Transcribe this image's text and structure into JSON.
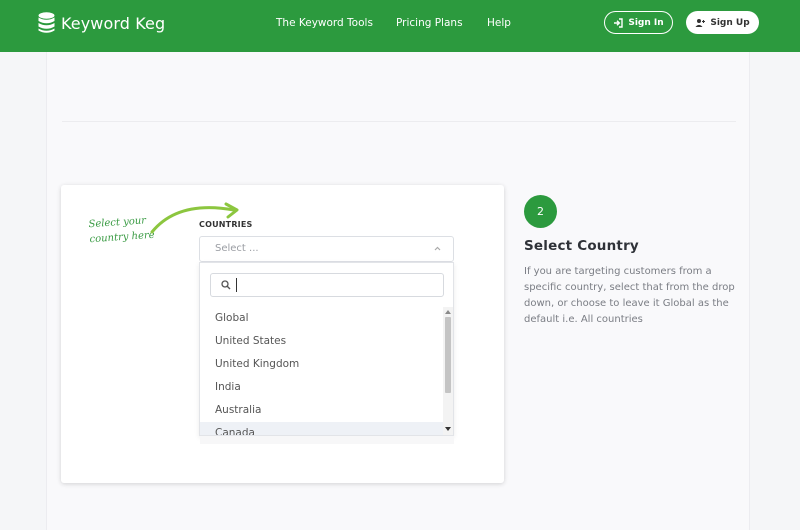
{
  "header": {
    "brand": "Keyword Keg",
    "nav": [
      "The Keyword Tools",
      "Pricing Plans",
      "Help"
    ],
    "signin_label": "Sign In",
    "signup_label": "Sign Up",
    "bg_color": "#2c9a3e"
  },
  "demo": {
    "annotation_line1": "Select your",
    "annotation_line2": "country here",
    "countries_label": "COUNTRIES",
    "select_placeholder": "Select ...",
    "search_value": "",
    "options": [
      "Global",
      "United States",
      "United Kingdom",
      "India",
      "Australia",
      "Canada"
    ],
    "highlighted_option": "Canada"
  },
  "step": {
    "number": "2",
    "title": "Select Country",
    "description": "If you are targeting customers from a specific country, select that from the drop down, or choose to leave it Global as the default i.e. All countries"
  },
  "icons": {
    "logo": "database-icon",
    "signin": "sign-in-icon",
    "signup": "user-plus-icon",
    "search": "search-icon",
    "chevron": "chevron-up-icon"
  }
}
